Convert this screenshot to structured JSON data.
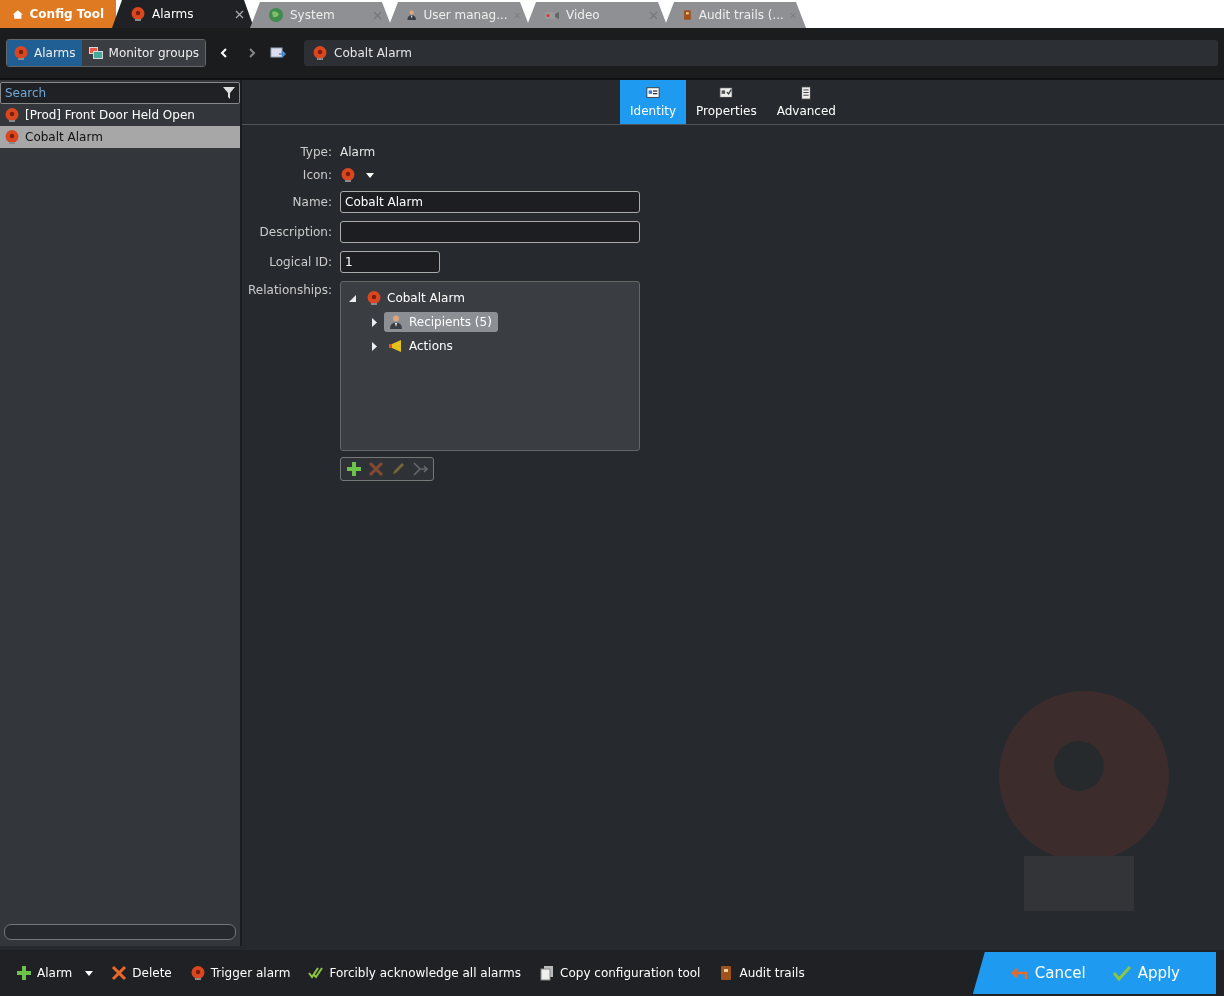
{
  "app_tab": {
    "label": "Config Tool"
  },
  "tabs": [
    {
      "label": "Alarms",
      "kind": "alarm",
      "selected": true
    },
    {
      "label": "System",
      "kind": "globe",
      "selected": false
    },
    {
      "label": "User manag...",
      "kind": "user",
      "selected": false
    },
    {
      "label": "Video",
      "kind": "video",
      "selected": false
    },
    {
      "label": "Audit trails (...",
      "kind": "book",
      "selected": false
    }
  ],
  "view_switch": [
    {
      "label": "Alarms",
      "kind": "alarm",
      "selected": true
    },
    {
      "label": "Monitor groups",
      "kind": "monitor",
      "selected": false
    }
  ],
  "breadcrumb": {
    "label": "Cobalt Alarm"
  },
  "sidebar": {
    "search": {
      "placeholder": "Search"
    },
    "items": [
      {
        "label": "[Prod] Front Door Held Open",
        "selected": false
      },
      {
        "label": "Cobalt Alarm",
        "selected": true
      }
    ]
  },
  "page_tabs": [
    {
      "label": "Identity",
      "kind": "identity",
      "selected": true
    },
    {
      "label": "Properties",
      "kind": "properties",
      "selected": false
    },
    {
      "label": "Advanced",
      "kind": "advanced",
      "selected": false
    }
  ],
  "identity": {
    "type_label": "Type:",
    "type_value": "Alarm",
    "icon_label": "Icon:",
    "name_label": "Name:",
    "name_value": "Cobalt Alarm",
    "description_label": "Description:",
    "logical_id_label": "Logical ID:",
    "logical_id_value": "1",
    "relationships_label": "Relationships:",
    "relationships": [
      {
        "label": "Cobalt Alarm",
        "kind": "alarm",
        "expanded": true,
        "selected": false,
        "children": [
          {
            "label": "Recipients (5)",
            "kind": "user",
            "expanded": false,
            "selected": true
          },
          {
            "label": "Actions",
            "kind": "action",
            "expanded": false,
            "selected": false
          }
        ]
      }
    ]
  },
  "bottom_bar": {
    "actions": [
      {
        "label": "Alarm",
        "kind": "plus",
        "dropdown": true
      },
      {
        "label": "Delete",
        "kind": "cross",
        "dropdown": false
      },
      {
        "label": "Trigger alarm",
        "kind": "alarm",
        "dropdown": false
      },
      {
        "label": "Forcibly acknowledge all alarms",
        "kind": "checks",
        "dropdown": false
      },
      {
        "label": "Copy configuration tool",
        "kind": "copy",
        "dropdown": false
      },
      {
        "label": "Audit trails",
        "kind": "book",
        "dropdown": false
      }
    ],
    "cancel": "Cancel",
    "apply": "Apply"
  }
}
